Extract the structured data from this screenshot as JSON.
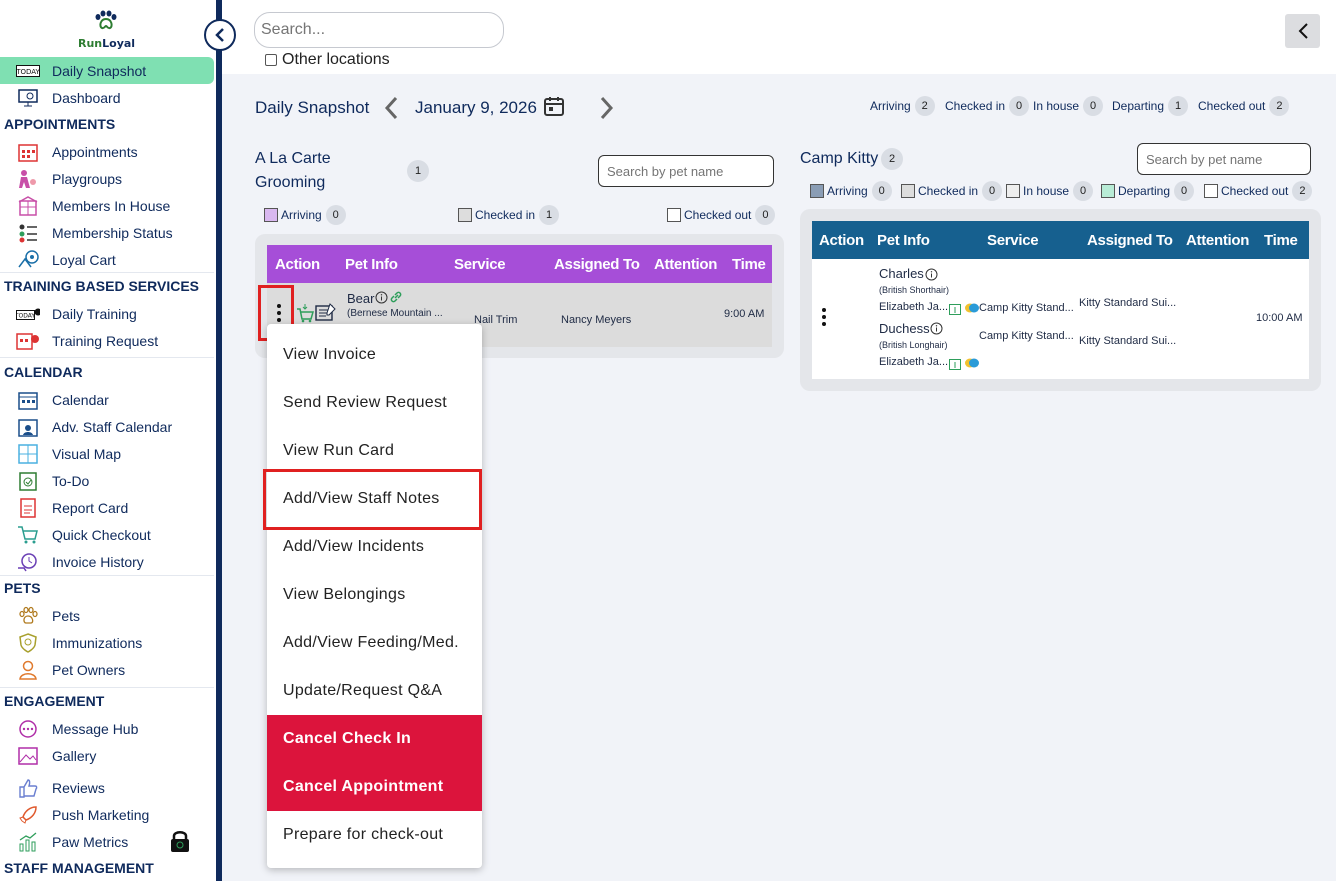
{
  "app": {
    "logo_text_a": "Run",
    "logo_text_b": "Loyal"
  },
  "sidebar": {
    "items": [
      {
        "label": "Daily Snapshot",
        "icon": "today-calendar-icon"
      },
      {
        "label": "Dashboard",
        "icon": "dashboard-monitor-icon"
      }
    ],
    "sections": [
      {
        "title": "APPOINTMENTS",
        "items": [
          "Appointments",
          "Playgroups",
          "Members In House",
          "Membership Status",
          "Loyal Cart"
        ]
      },
      {
        "title": "TRAINING BASED SERVICES",
        "items": [
          "Daily Training",
          "Training Request"
        ]
      },
      {
        "title": "CALENDAR",
        "items": [
          "Calendar",
          "Adv. Staff Calendar",
          "Visual Map",
          "To-Do",
          "Report Card",
          "Quick Checkout",
          "Invoice History"
        ]
      },
      {
        "title": "PETS",
        "items": [
          "Pets",
          "Immunizations",
          "Pet Owners"
        ]
      },
      {
        "title": "ENGAGEMENT",
        "items": [
          "Message Hub",
          "Gallery",
          "Reviews",
          "Push Marketing",
          "Paw Metrics"
        ]
      },
      {
        "title": "STAFF MANAGEMENT",
        "items": []
      }
    ]
  },
  "header": {
    "search_placeholder": "Search...",
    "other_locations": "Other locations"
  },
  "snapshot": {
    "title": "Daily Snapshot",
    "date": "January 9, 2026",
    "counts": [
      {
        "label": "Arriving",
        "value": "2"
      },
      {
        "label": "Checked in",
        "value": "0"
      },
      {
        "label": "In house",
        "value": "0"
      },
      {
        "label": "Departing",
        "value": "1"
      },
      {
        "label": "Checked out",
        "value": "2"
      }
    ]
  },
  "grooming": {
    "title_line1": "A La Carte",
    "title_line2": "Grooming",
    "count": "1",
    "search_placeholder": "Search by pet name",
    "legend": [
      {
        "label": "Arriving",
        "value": "0",
        "color": "#d9b8f0"
      },
      {
        "label": "Checked in",
        "value": "1",
        "color": "#dddddd"
      },
      {
        "label": "Checked out",
        "value": "0",
        "color": "#ffffff"
      }
    ],
    "header_color": "#a64ed8",
    "columns": [
      "Action",
      "Pet Info",
      "Service",
      "Assigned To",
      "Attention",
      "Time"
    ],
    "row": {
      "pet": "Bear",
      "breed": "(Bernese Mountain ...",
      "service": "Nail Trim",
      "assigned": "Nancy Meyers",
      "time": "9:00 AM"
    }
  },
  "camp": {
    "title": "Camp Kitty",
    "count": "2",
    "search_placeholder": "Search by pet name",
    "legend": [
      {
        "label": "Arriving",
        "value": "0",
        "color": "#8a9db5"
      },
      {
        "label": "Checked in",
        "value": "0",
        "color": "#dddddd"
      },
      {
        "label": "In house",
        "value": "0",
        "color": "#eeeeee"
      },
      {
        "label": "Departing",
        "value": "0",
        "color": "#b8ecd6"
      },
      {
        "label": "Checked out",
        "value": "2",
        "color": "#ffffff"
      }
    ],
    "header_color": "#16608f",
    "columns": [
      "Action",
      "Pet Info",
      "Service",
      "Assigned To",
      "Attention",
      "Time"
    ],
    "row": {
      "pet1": "Charles",
      "breed1": "(British Shorthair)",
      "owner1": "Elizabeth Ja...",
      "service1": "Camp Kitty Stand...",
      "assigned1": "Kitty Standard Sui...",
      "pet2": "Duchess",
      "breed2": "(British Longhair)",
      "owner2": "Elizabeth Ja...",
      "service2": "Camp Kitty Stand...",
      "assigned2": "Kitty Standard Sui...",
      "time": "10:00 AM"
    }
  },
  "context_menu": {
    "items": [
      "View Invoice",
      "Send Review Request",
      "View Run Card",
      "Add/View Staff Notes",
      "Add/View Incidents",
      "View Belongings",
      "Add/View Feeding/Med.",
      "Update/Request Q&A",
      "Cancel Check In",
      "Cancel Appointment",
      "Prepare for check-out"
    ],
    "danger_color": "#dc143c"
  }
}
